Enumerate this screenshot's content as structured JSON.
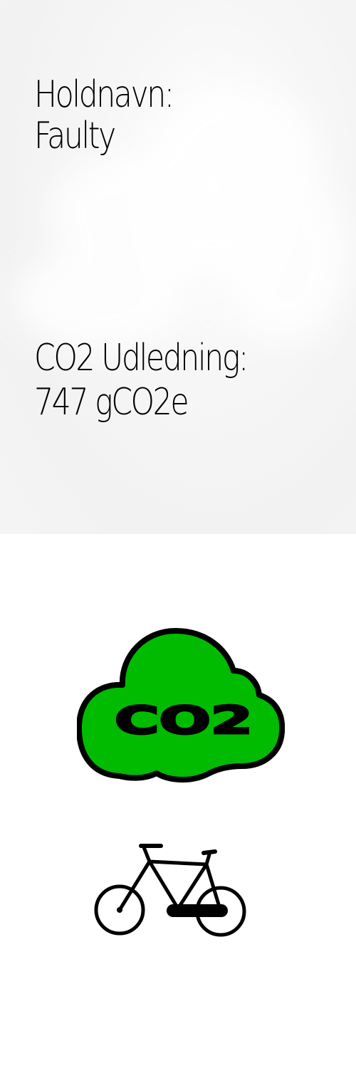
{
  "team": {
    "label": "Holdnavn:",
    "value": "Faulty"
  },
  "emission": {
    "label": "CO2 Udledning:",
    "value": "747 gCO2e"
  },
  "co2_badge": {
    "text": "CO2",
    "icon": "co2-cloud-icon",
    "fill_color": "#00bb00",
    "outline_color": "#000000"
  },
  "transport": {
    "icon": "bicycle-icon"
  }
}
